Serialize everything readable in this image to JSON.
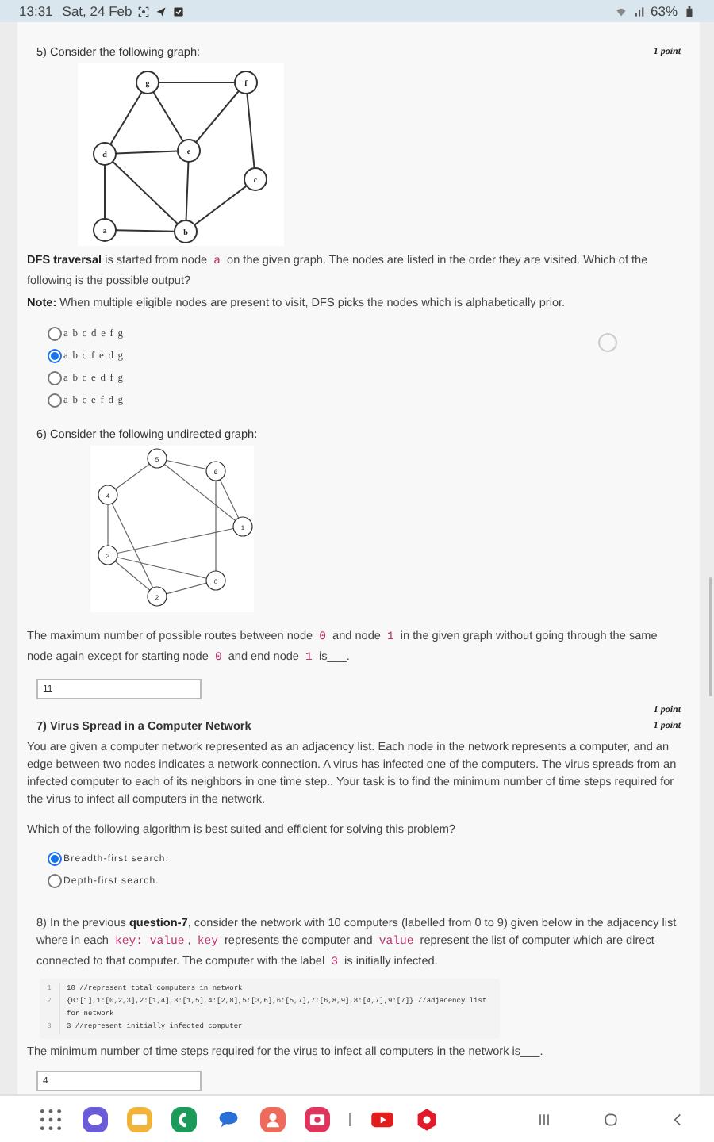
{
  "status_bar": {
    "time": "13:31",
    "date": "Sat, 24 Feb",
    "battery": "63%"
  },
  "questions": [
    {
      "number": "5)",
      "title": "Consider the following graph:",
      "title_bold": false,
      "points": "1 point",
      "graph": {
        "kind": "letters",
        "labels": [
          "g",
          "f",
          "d",
          "e",
          "c",
          "a",
          "b"
        ]
      },
      "body": [
        [
          {
            "text": "**DFS traversal** is started from node ",
            "code": false
          },
          {
            "text": "a",
            "code": true
          },
          {
            "text": " on the given graph. The nodes are listed in the order they are visited. Which of the following is the possible output?",
            "code": false
          }
        ],
        [
          {
            "text": "**Note:** When multiple eligible nodes are present to visit, DFS picks the nodes which is alphabetically prior.",
            "code": false
          }
        ]
      ],
      "options": [
        {
          "label": "a b c d e f g",
          "selected": false
        },
        {
          "label": "a b c f e d g",
          "selected": true
        },
        {
          "label": "a b c e d f g",
          "selected": false
        },
        {
          "label": "a b c e f d g",
          "selected": false
        }
      ]
    },
    {
      "number": "6)",
      "title": "Consider the following undirected graph:",
      "title_bold": false,
      "graph": {
        "kind": "numbers",
        "labels": [
          "5",
          "6",
          "4",
          "1",
          "3",
          "0",
          "2"
        ]
      },
      "body": [
        [
          {
            "text": "The maximum number of possible routes between node ",
            "code": false
          },
          {
            "text": "0",
            "code": true
          },
          {
            "text": " and node ",
            "code": false
          },
          {
            "text": "1",
            "code": true
          },
          {
            "text": " in the given graph without going through the same node again except for starting node ",
            "code": false
          },
          {
            "text": "0",
            "code": true
          },
          {
            "text": " and end node ",
            "code": false
          },
          {
            "text": "1",
            "code": true
          },
          {
            "text": " is___.",
            "code": false
          }
        ]
      ],
      "answer": "11",
      "points_after": "1 point"
    },
    {
      "number": "7)",
      "title": "Virus Spread in a Computer Network",
      "title_bold": true,
      "points": "1 point",
      "body": [
        [
          {
            "text": "You are given a computer network represented as an adjacency list. Each node in the network represents a computer, and an edge between two nodes indicates a network connection. A virus has infected one of the computers. The virus spreads from an infected computer to each of its neighbors in one time step.. Your task is to find the minimum number of time steps required for the virus to infect all computers in the network.",
            "code": false
          }
        ],
        [
          {
            "text": "Which of the following algorithm is best suited and efficient for solving this problem?",
            "code": false
          }
        ]
      ],
      "options": [
        {
          "label": "Breadth-first search.",
          "selected": true
        },
        {
          "label": "Depth-first search.",
          "selected": false
        }
      ]
    },
    {
      "number": "8)",
      "intro": [
        {
          "text": "In the previous **question-7**, consider the network with 10 computers (labelled from 0 to 9) given below in the adjacency list where in each ",
          "code": false
        },
        {
          "text": "key: value",
          "code": true
        },
        {
          "text": ", ",
          "code": false
        },
        {
          "text": "key",
          "code": true
        },
        {
          "text": " represents the computer and ",
          "code": false
        },
        {
          "text": "value",
          "code": true
        },
        {
          "text": " represent the list of computer which are direct connected to that computer. The computer with the label ",
          "code": false
        },
        {
          "text": "3",
          "code": true
        },
        {
          "text": " is initially infected.",
          "code": false
        }
      ],
      "code_lines": [
        {
          "number": "1",
          "text": "10 //represent total computers in network"
        },
        {
          "number": "2",
          "text": "{0:[1],1:[0,2,3],2:[1,4],3:[1,5],4:[2,8],5:[3,6],6:[5,7],7:[6,8,9],8:[4,7],9:[7]} //adjacency list for network"
        },
        {
          "number": "3",
          "text": "3 //represent initially infected computer"
        }
      ],
      "body": [
        [
          {
            "text": "The minimum number of time steps required for the virus to infect all computers in the network is___.",
            "code": false
          }
        ]
      ],
      "answer": "4"
    }
  ],
  "nav_bar": {
    "apps": [
      {
        "kind": "grid"
      },
      {
        "kind": "browser"
      },
      {
        "kind": "files"
      },
      {
        "kind": "phone"
      },
      {
        "kind": "chat"
      },
      {
        "kind": "contacts"
      },
      {
        "kind": "camera"
      }
    ],
    "pinned": [
      {
        "kind": "video"
      },
      {
        "kind": "recorder"
      }
    ]
  }
}
